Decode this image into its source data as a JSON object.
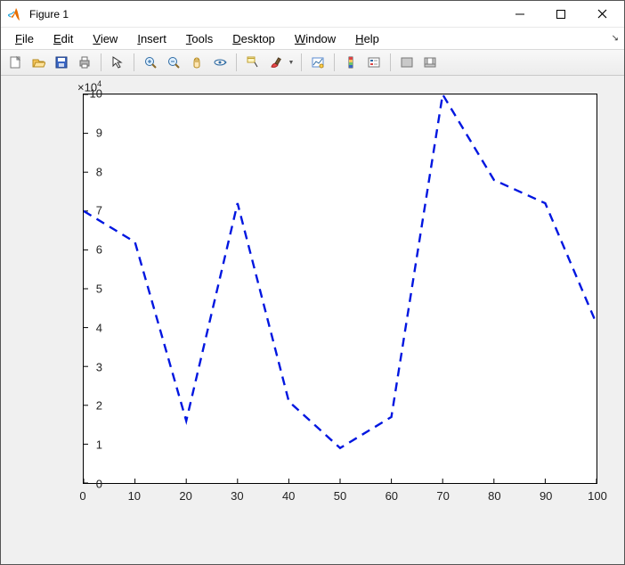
{
  "window": {
    "title": "Figure 1"
  },
  "menu": {
    "file": "File",
    "edit": "Edit",
    "view": "View",
    "insert": "Insert",
    "tools": "Tools",
    "desktop": "Desktop",
    "window": "Window",
    "help": "Help"
  },
  "chart_data": {
    "type": "line",
    "x": [
      0,
      10,
      20,
      30,
      40,
      50,
      60,
      70,
      80,
      90,
      100
    ],
    "y": [
      70000,
      62000,
      16000,
      72000,
      21000,
      9000,
      17000,
      100000,
      78000,
      72000,
      41000
    ],
    "xlim": [
      0,
      100
    ],
    "ylim": [
      0,
      100000
    ],
    "y_multiplier_label": "×10^4",
    "xticks": [
      0,
      10,
      20,
      30,
      40,
      50,
      60,
      70,
      80,
      90,
      100
    ],
    "yticks": [
      0,
      1,
      2,
      3,
      4,
      5,
      6,
      7,
      8,
      9,
      10
    ],
    "line_color": "#0016e0",
    "line_style": "dashed"
  }
}
